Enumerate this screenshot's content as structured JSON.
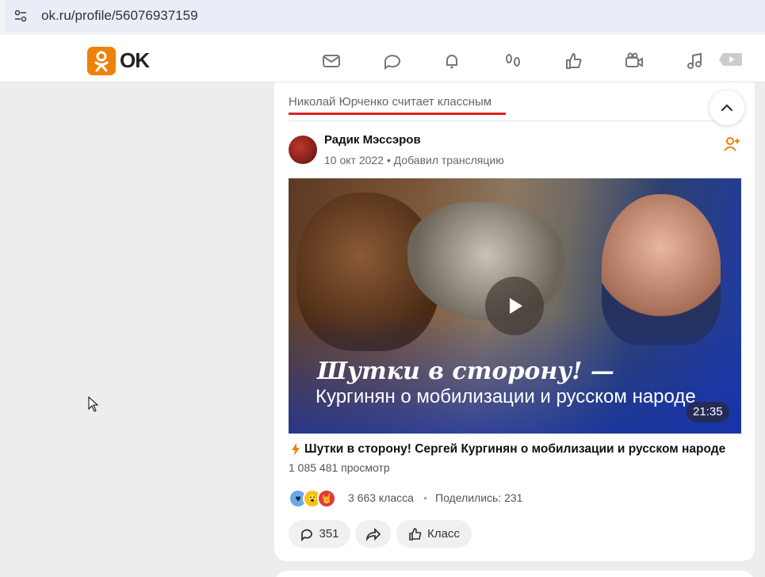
{
  "browser": {
    "url": "ok.ru/profile/56076937159"
  },
  "header": {
    "logo_text": "OK",
    "nav_icons": [
      "mail-icon",
      "chat-icon",
      "bell-icon",
      "footprints-icon",
      "like-icon",
      "video-camera-icon",
      "music-icon",
      "play-icon"
    ]
  },
  "feed": {
    "reason": "Николай Юрченко считает классным",
    "post": {
      "author": "Радик Мэссэров",
      "date": "10 окт 2022",
      "action": "Добавил трансляцию",
      "video": {
        "overlay_title": "Шутки в сторону! —",
        "overlay_subtitle": "Кургинян о мобилизации и русском народе",
        "duration": "21:35"
      },
      "title": "Шутки в сторону! Сергей Кургинян о мобилизации и русском народе",
      "views": "1 085 481 просмотр",
      "reactions_count": "3 663 класса",
      "shares": "Поделились: 231",
      "comments_count": "351",
      "like_label": "Класс"
    }
  },
  "colors": {
    "accent": "#ee8208",
    "underline": "#e02020"
  }
}
